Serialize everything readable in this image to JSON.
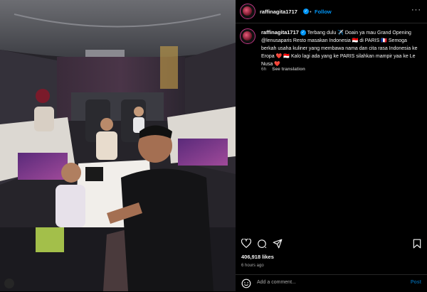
{
  "post": {
    "username": "raffinagita1717",
    "follow_label": "Follow",
    "caption_username": "raffinagita1717",
    "caption_text": "Terbang dulu ✈️ Doain ya mau Grand Opening @lenusaparis Resto masakan Indonesia 🇮🇩 di PARIS 🇫🇷 Semoga berkah usaha kuliner yang membawa nama dan cita rasa Indonesia ke Eropa ❤️ 🇮🇩 Kalo lagi ada yang ke PARIS silahkan mampir yaa ke Le Nusa ❤️",
    "caption_age": "6h",
    "see_translation": "See translation",
    "likes": "406,918 likes",
    "posted_ago": "6 hours ago",
    "comment_placeholder": "Add a comment...",
    "post_label": "Post"
  },
  "icons": {
    "more": "more-options-icon",
    "like": "heart-icon",
    "comment": "comment-icon",
    "share": "share-icon",
    "save": "bookmark-icon",
    "emoji": "emoji-icon",
    "verified": "verified-badge-icon"
  },
  "colors": {
    "link": "#0095f6",
    "secondary_text": "#a8a8a8",
    "divider": "#262626",
    "story_ring": "#c13584"
  }
}
